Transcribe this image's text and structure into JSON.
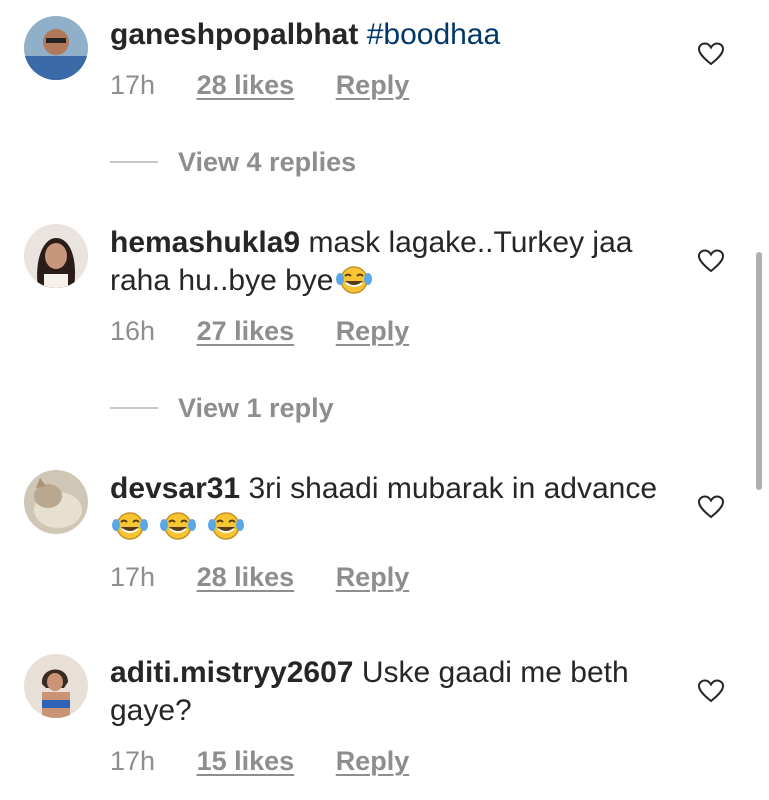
{
  "comments": [
    {
      "username": "ganeshpopalbhat",
      "text": "#boodhaa",
      "time": "17h",
      "likes": "28 likes",
      "reply": "Reply",
      "view_replies": "View 4 replies"
    },
    {
      "username": "hemashukla9",
      "text": "mask lagake..Turkey jaa raha hu..bye bye",
      "time": "16h",
      "likes": "27 likes",
      "reply": "Reply",
      "view_replies": "View 1 reply"
    },
    {
      "username": "devsar31",
      "text": "3ri shaadi mubarak in advance",
      "time": "17h",
      "likes": "28 likes",
      "reply": "Reply"
    },
    {
      "username": "aditi.mistryy2607",
      "text": "Uske gaadi me beth gaye?",
      "time": "17h",
      "likes": "15 likes",
      "reply": "Reply"
    }
  ],
  "icons": {
    "like": "heart-outline-icon",
    "emoji": "tears-of-joy-emoji"
  },
  "colors": {
    "text": "#262626",
    "secondary": "#8e8e8e",
    "hashtag": "#00376b"
  }
}
